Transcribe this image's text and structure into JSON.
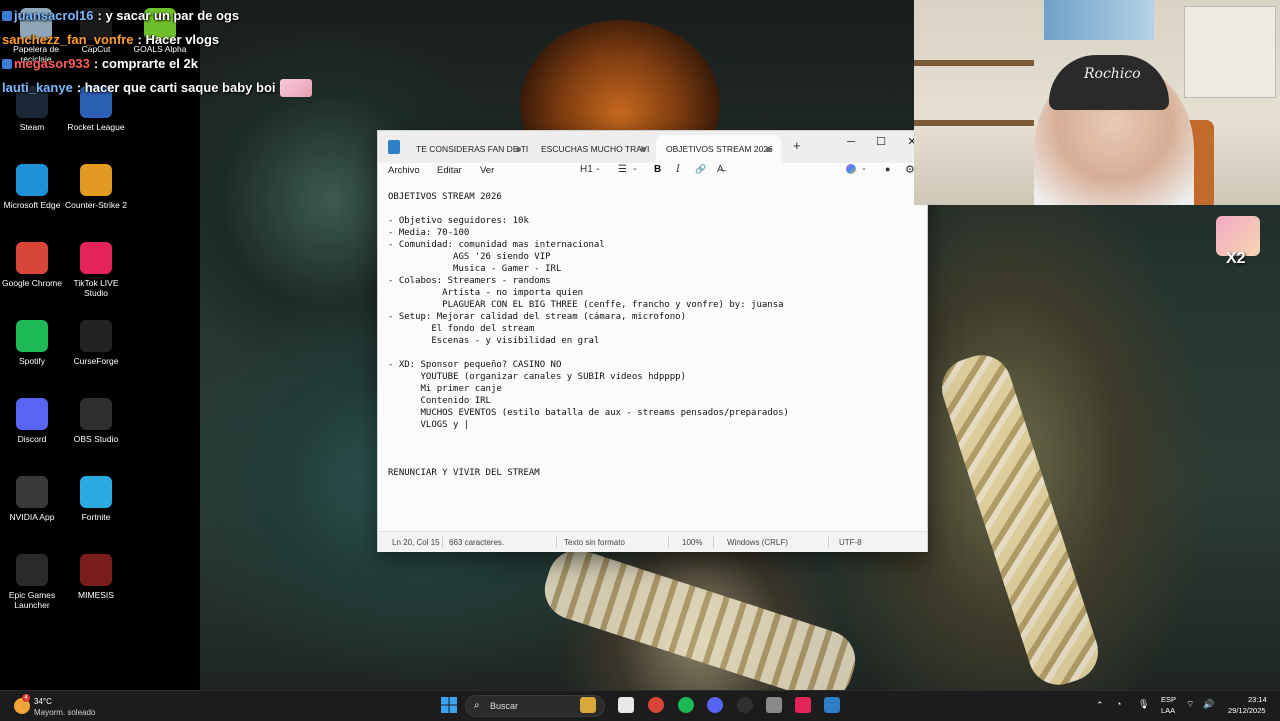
{
  "chat": [
    {
      "user": "juansacrol16",
      "user_color": "#7ab8ff",
      "message": ": y sacar un par de ogs",
      "badge_color": "#3a7bd5"
    },
    {
      "user": "sanchezz_fan_vonfre",
      "user_color": "#ff9c2b",
      "message": ": Hacer vlogs",
      "badge_color": ""
    },
    {
      "user": "megasor933",
      "user_color": "#ff5b5b",
      "message": ": comprarte el 2k",
      "badge_color": "#3a7bd5"
    },
    {
      "user": "lauti_kanye",
      "user_color": "#7ab8ff",
      "message": ": hacer que carti saque baby boi",
      "badge_color": ""
    }
  ],
  "desktop_icons": [
    {
      "label": "Papelera de reciclaje",
      "icon": "recycle-bin-icon",
      "color": "#8fa7b8"
    },
    {
      "label": "CapCut",
      "icon": "capcut-icon",
      "color": "#1b1b1b"
    },
    {
      "label": "GOALS Alpha",
      "icon": "goals-icon",
      "color": "#6fbf2a"
    },
    {
      "label": "Steam",
      "icon": "steam-icon",
      "color": "#1b2838"
    },
    {
      "label": "Rocket League",
      "icon": "rocket-league-icon",
      "color": "#2a5fb3"
    },
    {
      "label": "Microsoft Edge",
      "icon": "edge-icon",
      "color": "#1f8fd8"
    },
    {
      "label": "Counter-Strike 2",
      "icon": "counter-strike-icon",
      "color": "#e39a22"
    },
    {
      "label": "Google Chrome",
      "icon": "chrome-icon",
      "color": "#d8463a"
    },
    {
      "label": "TikTok LIVE Studio",
      "icon": "tiktok-icon",
      "color": "#e2245b"
    },
    {
      "label": "Spotify",
      "icon": "spotify-icon",
      "color": "#1db954"
    },
    {
      "label": "CurseForge",
      "icon": "curseforge-icon",
      "color": "#222222"
    },
    {
      "label": "Discord",
      "icon": "discord-icon",
      "color": "#5865f2"
    },
    {
      "label": "OBS Studio",
      "icon": "obs-icon",
      "color": "#302e31"
    },
    {
      "label": "NVIDIA App",
      "icon": "nvidia-icon",
      "color": "#3a3a3a"
    },
    {
      "label": "Fortnite",
      "icon": "fortnite-icon",
      "color": "#2aa8e0"
    },
    {
      "label": "Epic Games Launcher",
      "icon": "epic-games-icon",
      "color": "#2a2a2a"
    },
    {
      "label": "MIMESIS",
      "icon": "mimesis-icon",
      "color": "#7a1d1d"
    }
  ],
  "side_emote": {
    "multiplier": "X2"
  },
  "webcam": {
    "cap_text": "Rochico"
  },
  "notepad": {
    "tabs": [
      {
        "label": "TE CONSIDERAS FAN DE TI"
      },
      {
        "label": "ESCUCHAS MUCHO TRAVI"
      },
      {
        "label": "OBJETIVOS STREAM 2026"
      }
    ],
    "new_tab": "+",
    "window_buttons": {
      "minimize": "─",
      "maximize": "☐",
      "close": "✕"
    },
    "menus": {
      "file": "Archivo",
      "edit": "Editar",
      "view": "Ver"
    },
    "toolbar": {
      "heading": "H1",
      "list": "☰",
      "bold": "B",
      "italic": "I",
      "link": "🔗",
      "clear_format": "A̶"
    },
    "lines": [
      "OBJETIVOS STREAM 2026",
      "",
      "- Objetivo seguidores: 10k",
      "- Media: 70-100",
      "- Comunidad: comunidad mas internacional",
      "            AGS '26 siendo VIP",
      "            Musica - Gamer - IRL",
      "- Colabos: Streamers - randoms",
      "          Artista - no importa quien",
      "          PLAGUEAR CON EL BIG THREE (cenffe, francho y vonfre) by: juansa",
      "- Setup: Mejorar calidad del stream (cámara, microfono)",
      "        El fondo del stream",
      "        Escenas - y visibilidad en gral",
      "",
      "- XD: Sponsor pequeño? CASINO NO",
      "      YOUTUBE (organizar canales y SUBIR videos hdpppp)",
      "      Mi primer canje",
      "      Contenido IRL",
      "      MUCHOS EVENTOS (estilo batalla de aux - streams pensados/preparados)",
      "      VLOGS y |",
      "",
      "",
      "",
      "RENUNCIAR Y VIVIR DEL STREAM"
    ],
    "status": {
      "position": "Ln 20, Col 15",
      "chars": "663 caracteres.",
      "format": "Texto sin formato",
      "zoom": "100%",
      "line_ending": "Windows (CRLF)",
      "encoding": "UTF-8"
    }
  },
  "taskbar": {
    "weather": {
      "temp": "34°C",
      "desc": "Mayorm. soleado",
      "badge": "4"
    },
    "search_placeholder": "Buscar",
    "tray": {
      "lang": "ESP",
      "region": "LAA",
      "time": "23:14",
      "date": "29/12/2025"
    }
  },
  "colors": {
    "accent": "#2f7fc7",
    "taskbar": "#1c1c1c",
    "notepad_bg": "#fbfbfb"
  }
}
